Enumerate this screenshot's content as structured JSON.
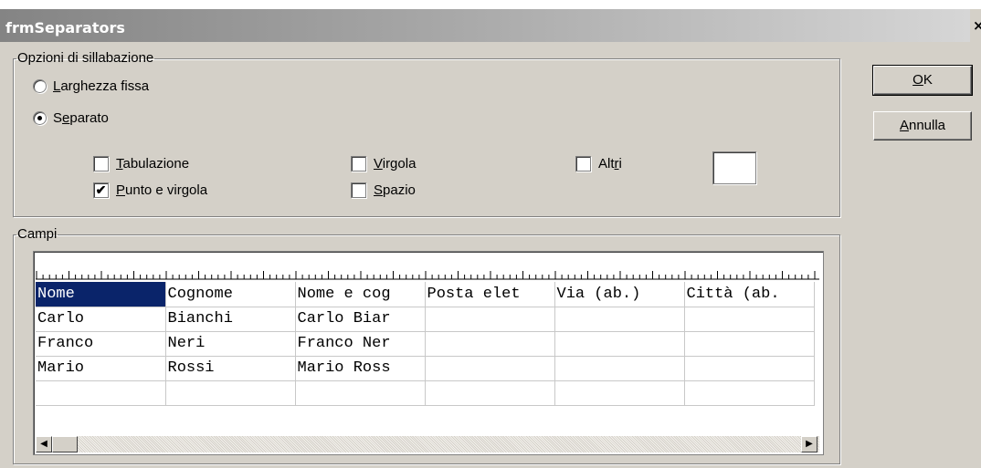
{
  "window": {
    "title": "frmSeparators",
    "close_glyph": "×"
  },
  "options_group": {
    "legend": "Opzioni di sillabazione",
    "fixed_width": {
      "mnemonic": "L",
      "rest": "arghezza fissa",
      "selected": false
    },
    "separated": {
      "pre": "S",
      "mnemonic": "e",
      "rest": "parato",
      "selected": true
    },
    "separators": {
      "tab": {
        "mnemonic": "T",
        "rest": "abulazione",
        "checked": false
      },
      "semicolon": {
        "mnemonic": "P",
        "rest": "unto e virgola",
        "checked": true,
        "mark": "✔"
      },
      "comma": {
        "mnemonic": "V",
        "rest": "irgola",
        "checked": false
      },
      "space": {
        "mnemonic": "S",
        "rest": "pazio",
        "checked": false
      },
      "other": {
        "pre": "Alt",
        "mnemonic": "r",
        "rest": "i",
        "checked": false,
        "value": ""
      }
    }
  },
  "buttons": {
    "ok": {
      "mnemonic": "O",
      "rest": "K"
    },
    "cancel": {
      "mnemonic": "A",
      "rest": "nnulla"
    }
  },
  "fields_group": {
    "legend": "Campi",
    "columns": [
      "Nome",
      "Cognome",
      "Nome e cog",
      "Posta elet",
      "Via (ab.)",
      "Città (ab."
    ],
    "rows": [
      [
        "Carlo",
        "Bianchi",
        "Carlo Biar",
        "",
        "",
        ""
      ],
      [
        "Franco",
        "Neri",
        "Franco Ner",
        "",
        "",
        ""
      ],
      [
        "Mario",
        "Rossi",
        "Mario Ross",
        "",
        "",
        ""
      ],
      [
        "",
        "",
        "",
        "",
        "",
        ""
      ]
    ],
    "scroll": {
      "left_icon": "◀",
      "right_icon": "▶"
    }
  },
  "icons": {
    "close": "close-icon",
    "left": "scroll-left-icon",
    "right": "scroll-right-icon"
  }
}
